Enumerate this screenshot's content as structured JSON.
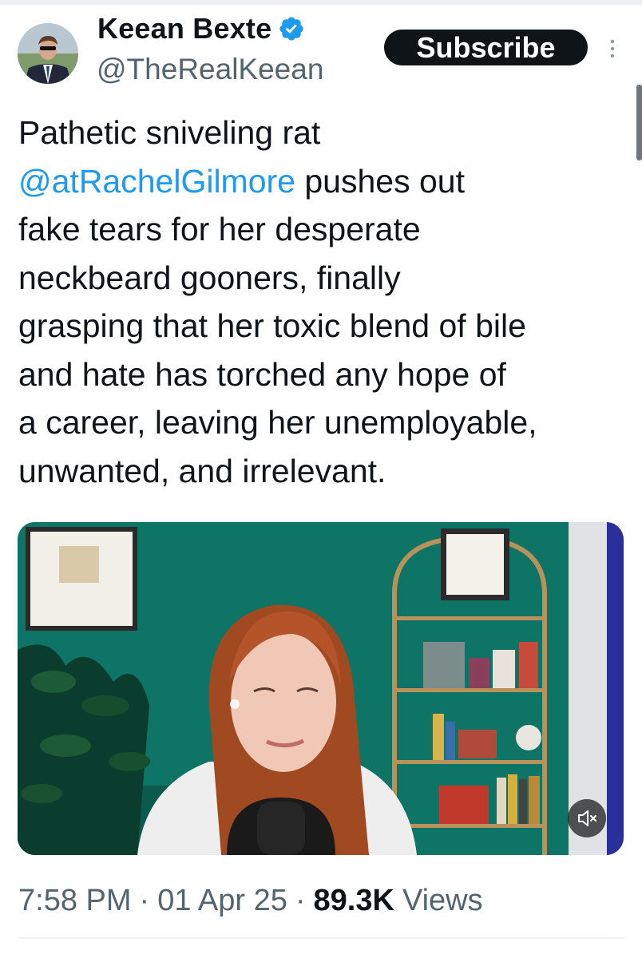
{
  "author": {
    "name": "Keean Bexte",
    "handle": "@TheRealKeean",
    "verified": true,
    "avatar_icon": "profile-photo"
  },
  "header": {
    "subscribe_label": "Subscribe",
    "more_icon": "more-vertical-icon"
  },
  "tweet": {
    "lines": [
      [
        "Pathetic sniveling rat"
      ],
      [
        "@atRachelGilmore",
        " pushes out"
      ],
      [
        "fake tears for her desperate"
      ],
      [
        "neckbeard gooners, finally"
      ],
      [
        "grasping that her toxic blend of bile"
      ],
      [
        "and hate has torched any hope of"
      ],
      [
        "a career, leaving her unemployable,"
      ],
      [
        "unwanted, and irrelevant."
      ]
    ],
    "mention": "@atRachelGilmore"
  },
  "media": {
    "type": "video",
    "muted": true,
    "mute_icon": "volume-muted-icon"
  },
  "meta": {
    "time": "7:58 PM",
    "date": "01 Apr 25",
    "separator": "·",
    "views_count": "89.3K",
    "views_label": "Views"
  },
  "colors": {
    "text": "#0f1419",
    "secondary": "#536471",
    "link": "#1d9bf0",
    "verified": "#1d9bf0",
    "button_bg": "#0f1419"
  }
}
